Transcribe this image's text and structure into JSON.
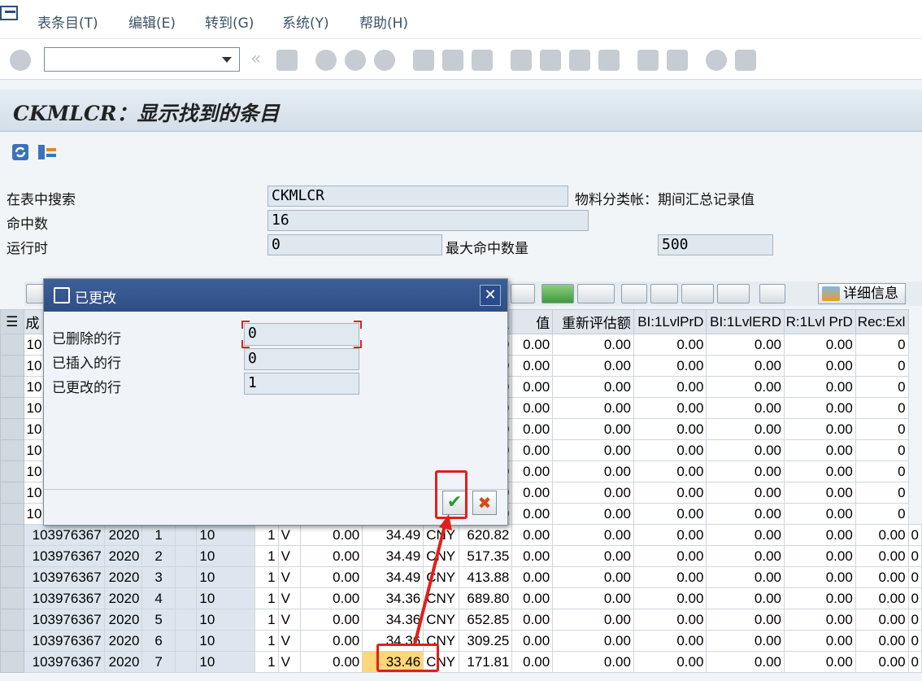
{
  "menu": {
    "items": [
      "表条目(T)",
      "编辑(E)",
      "转到(G)",
      "系统(Y)",
      "帮助(H)"
    ]
  },
  "title": "CKMLCR：显示找到的条目",
  "selection": {
    "search_label": "在表中搜索",
    "search_value": "CKMLCR",
    "search_desc": "物料分类帐：期间汇总记录值",
    "hits_label": "命中数",
    "hits_value": "16",
    "runtime_label": "运行时",
    "runtime_value": "0",
    "maxhits_label": "最大命中数量",
    "maxhits_value": "500"
  },
  "grid_toolbar": {
    "detail_label": "详细信息"
  },
  "grid": {
    "header_first": "成",
    "headers_right": [
      "值",
      "值",
      "重新评估额",
      "BI:1LvlPrD",
      "BI:1LvlERD",
      "R:1Lvl PrD",
      "Rec:Exl"
    ],
    "hidden_rows": [
      {
        "c0": "10",
        "c9": "00"
      },
      {
        "c0": "10",
        "c9": "00"
      },
      {
        "c0": "10",
        "c9": "00"
      },
      {
        "c0": "10",
        "c9": "99"
      },
      {
        "c0": "10",
        "c9": "67"
      },
      {
        "c0": "10",
        "c9": "19"
      },
      {
        "c0": "10",
        "c9": "94"
      },
      {
        "c0": "10",
        "c9": "45"
      },
      {
        "c0": "10",
        "c9": "49"
      }
    ],
    "rows": [
      {
        "mat": "103976367",
        "year": "2020",
        "per": "1",
        "t": "10",
        "u": "1",
        "v": "V",
        "a": "0.00",
        "price": "34.49",
        "cur": "CNY",
        "amt": "620.82"
      },
      {
        "mat": "103976367",
        "year": "2020",
        "per": "2",
        "t": "10",
        "u": "1",
        "v": "V",
        "a": "0.00",
        "price": "34.49",
        "cur": "CNY",
        "amt": "517.35"
      },
      {
        "mat": "103976367",
        "year": "2020",
        "per": "3",
        "t": "10",
        "u": "1",
        "v": "V",
        "a": "0.00",
        "price": "34.49",
        "cur": "CNY",
        "amt": "413.88"
      },
      {
        "mat": "103976367",
        "year": "2020",
        "per": "4",
        "t": "10",
        "u": "1",
        "v": "V",
        "a": "0.00",
        "price": "34.36",
        "cur": "CNY",
        "amt": "689.80"
      },
      {
        "mat": "103976367",
        "year": "2020",
        "per": "5",
        "t": "10",
        "u": "1",
        "v": "V",
        "a": "0.00",
        "price": "34.36",
        "cur": "CNY",
        "amt": "652.85"
      },
      {
        "mat": "103976367",
        "year": "2020",
        "per": "6",
        "t": "10",
        "u": "1",
        "v": "V",
        "a": "0.00",
        "price": "34.36",
        "cur": "CNY",
        "amt": "309.25"
      },
      {
        "mat": "103976367",
        "year": "2020",
        "per": "7",
        "t": "10",
        "u": "1",
        "v": "V",
        "a": "0.00",
        "price": "33.46",
        "cur": "CNY",
        "amt": "171.81"
      }
    ],
    "zero": "0.00",
    "last_zero": "0"
  },
  "dialog": {
    "title": "已更改",
    "deleted_label": "已删除的行",
    "deleted_value": "0",
    "inserted_label": "已插入的行",
    "inserted_value": "0",
    "changed_label": "已更改的行",
    "changed_value": "1"
  },
  "colors": {
    "highlight": "#ffd77a",
    "annotation": "#e0201b",
    "dialog_header": "#2e4d84"
  }
}
